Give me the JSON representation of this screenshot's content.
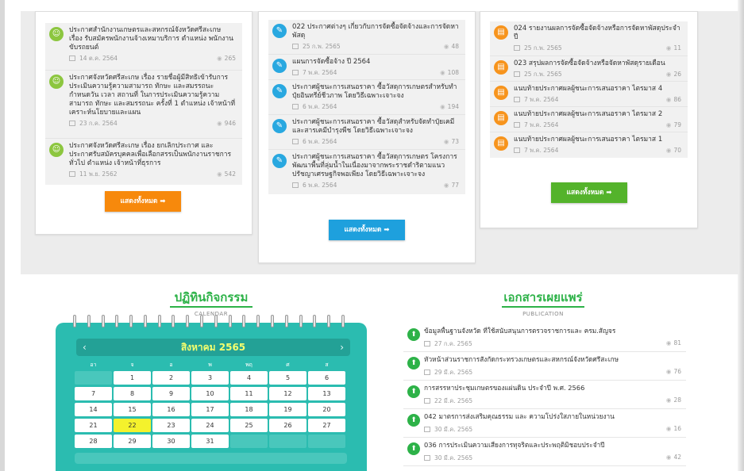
{
  "columns": [
    {
      "color": "#8cc63f",
      "icon": "person-icon",
      "icon_glyph": "☺",
      "button_label": "แสดงทั้งหมด ➡",
      "button_color": "#f7890c",
      "items": [
        {
          "title": "ประกาศสำนักงานเกษตรและสหกรณ์จังหวัดศรีสะเกษ เรื่อง รับสมัครพนักงานจ้างเหมาบริการ ตำแหน่ง พนักงานขับรถยนต์",
          "date": "14 ต.ค. 2564",
          "views": "265"
        },
        {
          "title": "ประกาศจังหวัดศรีสะเกษ เรื่อง รายชื่อผู้มีสิทธิเข้ารับการประเมินความรู้ความสามารถ ทักษะ และสมรรถนะ กำหนดวัน เวลา สถานที่ ในการประเมินความรู้ความสามารถ ทักษะ และสมรรถนะ ครั้งที่ 1 ตำแหน่ง เจ้าหน้าที่เคราะห์นโยบายและแผน",
          "date": "23 ก.ค. 2564",
          "views": "946"
        },
        {
          "title": "ประกาศจังหวัดศรีสะเกษ เรื่อง ยกเลิกประกาศ และประกาศรับสมัครบุคคลเพื่อเลือกสรรเป็นพนักงานราชการทั่วไป ตำแหน่ง เจ้าหน้าที่ธุรการ",
          "date": "11 พ.ย. 2562",
          "views": "542"
        }
      ]
    },
    {
      "color": "#29a8e0",
      "icon": "megaphone-icon",
      "icon_glyph": "✎",
      "button_label": "แสดงทั้งหมด ➡",
      "button_color": "#1ea0dd",
      "items": [
        {
          "title": "022 ประกาศต่างๆ เกี่ยวกับการจัดซื้อจัดจ้างและการจัดหาพัสดุ",
          "date": "25 ก.พ. 2565",
          "views": "48"
        },
        {
          "title": "แผนการจัดซื้อจ้าง ปี 2564",
          "date": "7 พ.ค. 2564",
          "views": "108"
        },
        {
          "title": "ประกาศผู้ชนะการเสนอราคา ซื้อวัสดุการเกษตรสำหรับทำปุ๋ยอินทรีย์ชีวภาพ โดยวิธีเฉพาะเจาะจง",
          "date": "6 พ.ค. 2564",
          "views": "194"
        },
        {
          "title": "ประกาศผู้ชนะการเสนอราคา ซื้อวัสดุสำหรับจัดทำปุ๋ยเคมีและสารเคมีบำรุงพืช โดยวิธีเฉพาะเจาะจง",
          "date": "6 พ.ค. 2564",
          "views": "73"
        },
        {
          "title": "ประกาศผู้ชนะการเสนอราคา ซื้อวัสดุการเกษตร โครงการพัฒนาพื้นที่ลุ่มน้ำในเนื่องมาจากพระราชดำริตามแนว ปรัชญาเศรษฐกิจพอเพียง โดยวิธีเฉพาะเจาะจง",
          "date": "6 พ.ค. 2564",
          "views": "77"
        }
      ]
    },
    {
      "color": "#f7941d",
      "icon": "document-icon",
      "icon_glyph": "▤",
      "button_label": "แสดงทั้งหมด ➡",
      "button_color": "#54b32b",
      "items": [
        {
          "title": "024 รายงานผลการจัดซื้อจัดจ้างหรือการจัดหาพัสดุประจำปี",
          "date": "25 ก.พ. 2565",
          "views": "11"
        },
        {
          "title": "023 สรุปผลการจัดซื้อจัดจ้างหรือจัดหาพัสดุรายเดือน",
          "date": "25 ก.พ. 2565",
          "views": "26"
        },
        {
          "title": "แนบท้ายประกาศผลผู้ชนะการเสนอราคา ไตรมาส 4",
          "date": "7 พ.ค. 2564",
          "views": "86"
        },
        {
          "title": "แนบท้ายประกาศผลผู้ชนะการเสนอราคา ไตรมาส 2",
          "date": "7 พ.ค. 2564",
          "views": "79"
        },
        {
          "title": "แนบท้ายประกาศผลผู้ชนะการเสนอราคา ไตรมาส 1",
          "date": "7 พ.ค. 2564",
          "views": "70"
        }
      ]
    }
  ],
  "calendar": {
    "title": "ปฏิทินกิจกรรม",
    "subtitle": "CALENDAR",
    "month": "สิงหาคม 2565",
    "prev": "‹",
    "next": "›",
    "weekdays": [
      "อา",
      "จ",
      "อ",
      "พ",
      "พฤ",
      "ศ",
      "ส"
    ],
    "weeks": [
      [
        "",
        "1",
        "2",
        "3",
        "4",
        "5",
        "6"
      ],
      [
        "7",
        "8",
        "9",
        "10",
        "11",
        "12",
        "13"
      ],
      [
        "14",
        "15",
        "16",
        "17",
        "18",
        "19",
        "20"
      ],
      [
        "21",
        "22",
        "23",
        "24",
        "25",
        "26",
        "27"
      ],
      [
        "28",
        "29",
        "30",
        "31",
        "",
        "",
        ""
      ]
    ],
    "today": "22",
    "bg_color": "#2bbcb0",
    "today_color": "#f4f22c"
  },
  "publication": {
    "title": "เอกสารเผยแพร่",
    "subtitle": "PUBLICATION",
    "icon": "download-icon",
    "icon_glyph": "⬆",
    "items": [
      {
        "title": "ข้อมูลพื้นฐานจังหวัด ที่ใช้สนับสนุนการตรวจราชการและ ครม.สัญจร",
        "date": "27 ก.ค. 2565",
        "views": "81"
      },
      {
        "title": "หัวหน้าส่วนราชการสังกัดกระทรวงเกษตรและสหกรณ์จังหวัดศรีสะเกษ",
        "date": "29 มี.ค. 2565",
        "views": "76"
      },
      {
        "title": "การสรรหาประชุมเกษตรของแผ่นดิน ประจำปี พ.ศ. 2566",
        "date": "22 มี.ค. 2565",
        "views": "28"
      },
      {
        "title": "042 มาตรการส่งเสริมคุณธรรม และ ความโปร่งใสภายในหน่วยงาน",
        "date": "30 มี.ค. 2565",
        "views": "16"
      },
      {
        "title": "036 การประเมินความเสี่ยงการทุจริตและประพฤติมิชอบประจำปี",
        "date": "30 มี.ค. 2565",
        "views": "42"
      }
    ]
  },
  "accent_green": "#2db248"
}
